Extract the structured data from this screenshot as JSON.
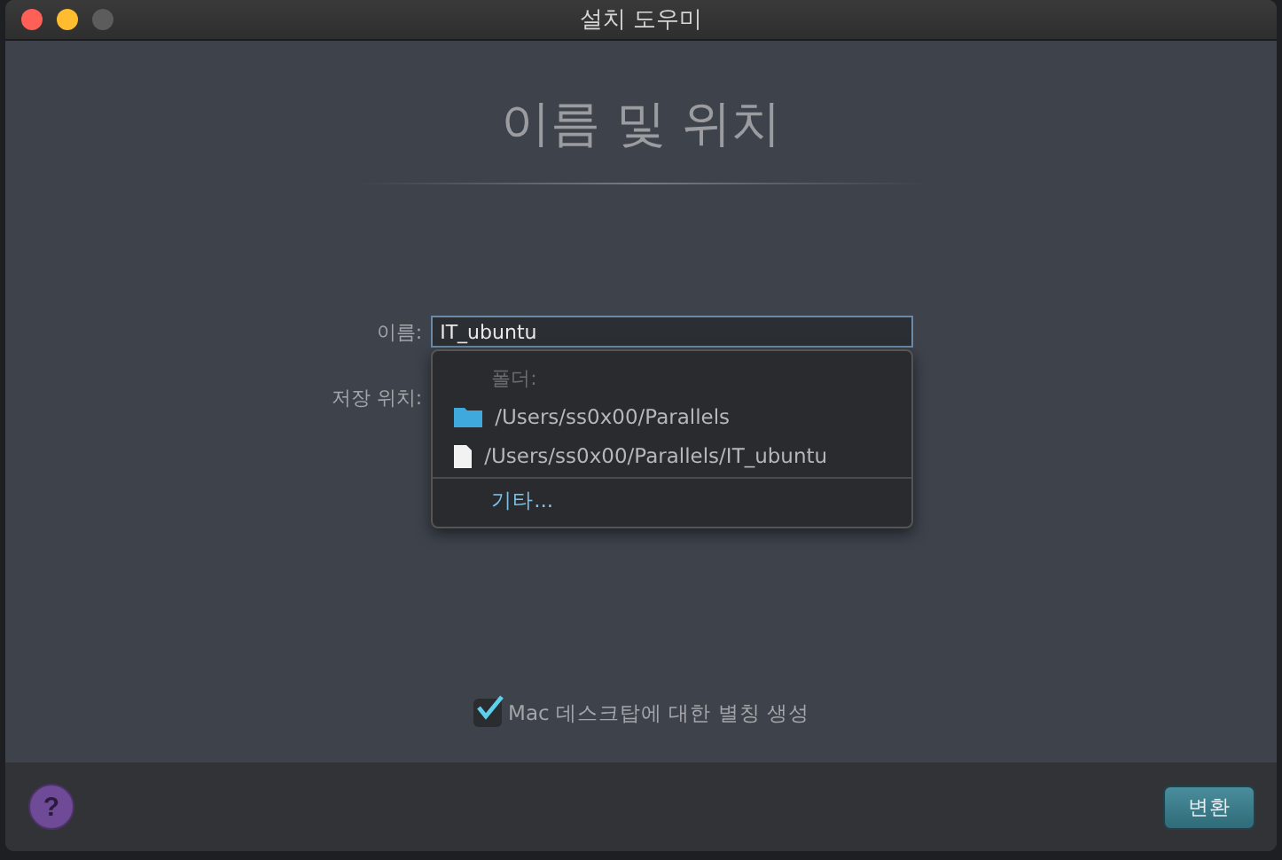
{
  "window": {
    "title": "설치 도우미"
  },
  "heading": "이름 및 위치",
  "form": {
    "name_label": "이름:",
    "name_value": "IT_ubuntu",
    "location_label": "저장 위치:"
  },
  "location_menu": {
    "header": "폴더:",
    "items": [
      {
        "kind": "folder",
        "label": "/Users/ss0x00/Parallels"
      },
      {
        "kind": "file",
        "label": "/Users/ss0x00/Parallels/IT_ubuntu"
      },
      {
        "kind": "other",
        "label": "기타..."
      }
    ]
  },
  "alias_checkbox": {
    "label": "Mac 데스크탑에 대한 별칭 생성",
    "checked": true
  },
  "footer": {
    "help": "?",
    "convert_button": "변환"
  }
}
